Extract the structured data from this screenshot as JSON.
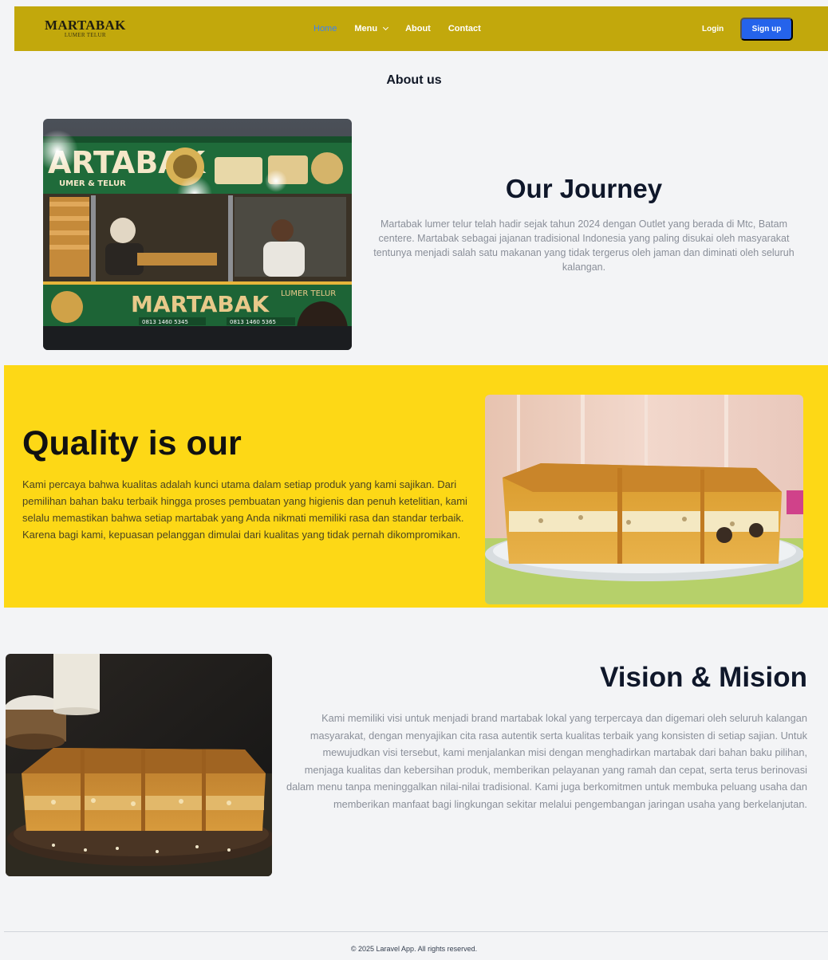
{
  "brand": {
    "name": "MARTABAK",
    "tagline": "LUMER TELUR"
  },
  "nav": {
    "links": [
      {
        "label": "Home",
        "active": true
      },
      {
        "label": "Menu",
        "dropdown": true
      },
      {
        "label": "About"
      },
      {
        "label": "Contact"
      }
    ],
    "login": "Login",
    "signup": "Sign up"
  },
  "page": {
    "heading": "About us"
  },
  "journey": {
    "title": "Our Journey",
    "text": "Martabak lumer telur telah hadir sejak tahun 2024 dengan Outlet yang berada di Mtc, Batam centere. Martabak sebagai jajanan tradisional Indonesia yang paling disukai oleh masyarakat tentunya menjadi salah satu makanan yang tidak tergerus oleh jaman dan diminati oleh seluruh kalangan.",
    "image": {
      "banner_top": "ARTABAK",
      "banner_top_sub": "UMER & TELUR",
      "banner_bottom": "MARTABAK",
      "banner_bottom_sub": "LUMER TELUR",
      "phone_1": "0813 1460 5345",
      "phone_2": "0813 1460 5365"
    }
  },
  "quality": {
    "title": "Quality is our",
    "text": "Kami percaya bahwa kualitas adalah kunci utama dalam setiap produk yang kami sajikan. Dari pemilihan bahan baku terbaik hingga proses pembuatan yang higienis dan penuh ketelitian, kami selalu memastikan bahwa setiap martabak yang Anda nikmati memiliki rasa dan standar terbaik. Karena bagi kami, kepuasan pelanggan dimulai dari kualitas yang tidak pernah dikompromikan."
  },
  "vision": {
    "title": "Vision & Mision",
    "text": "Kami memiliki visi untuk menjadi brand martabak lokal yang terpercaya dan digemari oleh seluruh kalangan masyarakat, dengan menyajikan cita rasa autentik serta kualitas terbaik yang konsisten di setiap sajian. Untuk mewujudkan visi tersebut, kami menjalankan misi dengan menghadirkan martabak dari bahan baku pilihan, menjaga kualitas dan kebersihan produk, memberikan pelayanan yang ramah dan cepat, serta terus berinovasi dalam menu tanpa meninggalkan nilai-nilai tradisional. Kami juga berkomitmen untuk membuka peluang usaha dan memberikan manfaat bagi lingkungan sekitar melalui pengembangan jaringan usaha yang berkelanjutan."
  },
  "footer": {
    "text": "© 2025 Laravel App. All rights reserved."
  },
  "colors": {
    "navbar": "#c2a80c",
    "accent": "#2563eb",
    "quality_band": "#fdd816",
    "background": "#f3f4f6"
  }
}
